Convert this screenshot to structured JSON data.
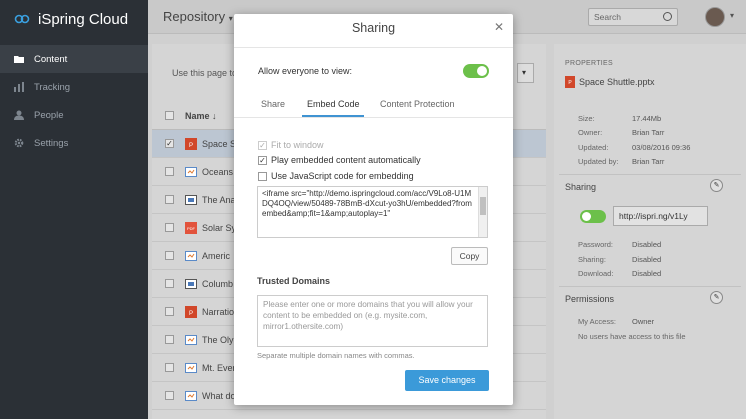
{
  "app": {
    "name": "iSpring Cloud"
  },
  "sidebar": {
    "items": [
      {
        "label": "Content",
        "icon": "folder-icon",
        "active": true
      },
      {
        "label": "Tracking",
        "icon": "bar-chart-icon",
        "active": false
      },
      {
        "label": "People",
        "icon": "person-icon",
        "active": false
      },
      {
        "label": "Settings",
        "icon": "gear-icon",
        "active": false
      }
    ]
  },
  "topbar": {
    "repository": "Repository",
    "search_placeholder": "Search"
  },
  "content": {
    "hint": "Use this page to",
    "column_name": "Name",
    "files": [
      {
        "name": "Space S",
        "type": "pptx",
        "selected": true
      },
      {
        "name": "Oceans",
        "type": "quiz",
        "selected": false
      },
      {
        "name": "The Ana",
        "type": "video",
        "selected": false
      },
      {
        "name": "Solar Sy",
        "type": "pdf",
        "selected": false
      },
      {
        "name": "Americ",
        "type": "quiz",
        "selected": false
      },
      {
        "name": "Columb",
        "type": "video",
        "selected": false
      },
      {
        "name": "Narratio",
        "type": "pptx",
        "selected": false
      },
      {
        "name": "The Olym",
        "type": "quiz",
        "selected": false
      },
      {
        "name": "Mt. Ever",
        "type": "quiz",
        "selected": false
      },
      {
        "name": "What do",
        "type": "quiz",
        "selected": false
      }
    ]
  },
  "properties": {
    "header": "PROPERTIES",
    "filename": "Space Shuttle.pptx",
    "size_label": "Size:",
    "size": "17.44Mb",
    "owner_label": "Owner:",
    "owner": "Brian Tarr",
    "updated_label": "Updated:",
    "updated": "03/08/2016 09:36",
    "updated_by_label": "Updated by:",
    "updated_by": "Brian Tarr",
    "sharing_title": "Sharing",
    "share_link": "http://ispri.ng/v1Ly",
    "password_label": "Password:",
    "password": "Disabled",
    "sharing_label": "Sharing:",
    "sharing": "Disabled",
    "download_label": "Download:",
    "download": "Disabled",
    "permissions_title": "Permissions",
    "my_access_label": "My Access:",
    "my_access": "Owner",
    "no_access_note": "No users have access to this file"
  },
  "modal": {
    "title": "Sharing",
    "allow_label": "Allow everyone to view:",
    "allow_on": true,
    "tabs": [
      "Share",
      "Embed Code",
      "Content Protection"
    ],
    "active_tab": "Embed Code",
    "options": [
      {
        "label": "Fit to window",
        "checked": true,
        "disabled": true
      },
      {
        "label": "Play embedded content automatically",
        "checked": true,
        "disabled": false
      },
      {
        "label": "Use JavaScript code for embedding",
        "checked": false,
        "disabled": false
      }
    ],
    "code": "<iframe src=\"http://demo.ispringcloud.com/acc/V9Lo8-U1MDQ4OQ/view/50489-78BmB-dXcut-yo3hU/embedded?fromembed&amp;fit=1&amp;autoplay=1\"",
    "copy_label": "Copy",
    "trusted_title": "Trusted Domains",
    "trusted_placeholder": "Please enter one or more domains that you will allow your content to be embedded on (e.g. mysite.com, mirror1.othersite.com)",
    "trusted_help": "Separate multiple domain names with commas.",
    "save_label": "Save changes"
  },
  "colors": {
    "accent": "#3b9ad9",
    "toggle_on": "#6cc04a",
    "pdf": "#e2533c",
    "pptx": "#d1472a"
  }
}
